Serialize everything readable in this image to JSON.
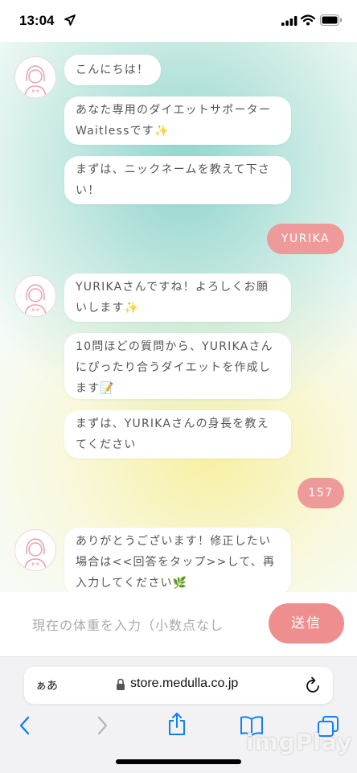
{
  "status_bar": {
    "time": "13:04"
  },
  "icons": {
    "location": "location-arrow-icon",
    "signal": "cellular-signal-icon",
    "wifi": "wifi-icon",
    "battery": "battery-icon",
    "avatar": "woman-avatar-icon",
    "lock": "lock-icon",
    "reload": "reload-icon",
    "back": "chevron-left-icon",
    "forward": "chevron-right-icon",
    "share": "share-icon",
    "bookmarks": "book-icon",
    "tabs": "tabs-icon"
  },
  "colors": {
    "accent": "#ef9a9a",
    "send": "#ef8e8e",
    "ios_blue": "#147efb"
  },
  "chat": {
    "group1": [
      "こんにちは！",
      "あなた専用のダイエットサポーターWaitlessです✨",
      "まずは、ニックネームを教えて下さい！"
    ],
    "user_reply1": "YURIKA",
    "group2": [
      "YURIKAさんですね！よろしくお願いします✨",
      "10問ほどの質問から、YURIKAさんにぴったり合うダイエットを作成します📝",
      "まずは、YURIKAさんの身長を教えてください"
    ],
    "user_reply2": "157",
    "group3": [
      "ありがとうございます！修正したい場合は<<回答をタップ>>して、再入力してください🌿"
    ]
  },
  "input": {
    "placeholder": "現在の体重を入力（小数点なし",
    "send_label": "送信"
  },
  "browser": {
    "aa_label": "ぁあ",
    "url": "store.medulla.co.jp"
  },
  "watermark": "imgPlay"
}
